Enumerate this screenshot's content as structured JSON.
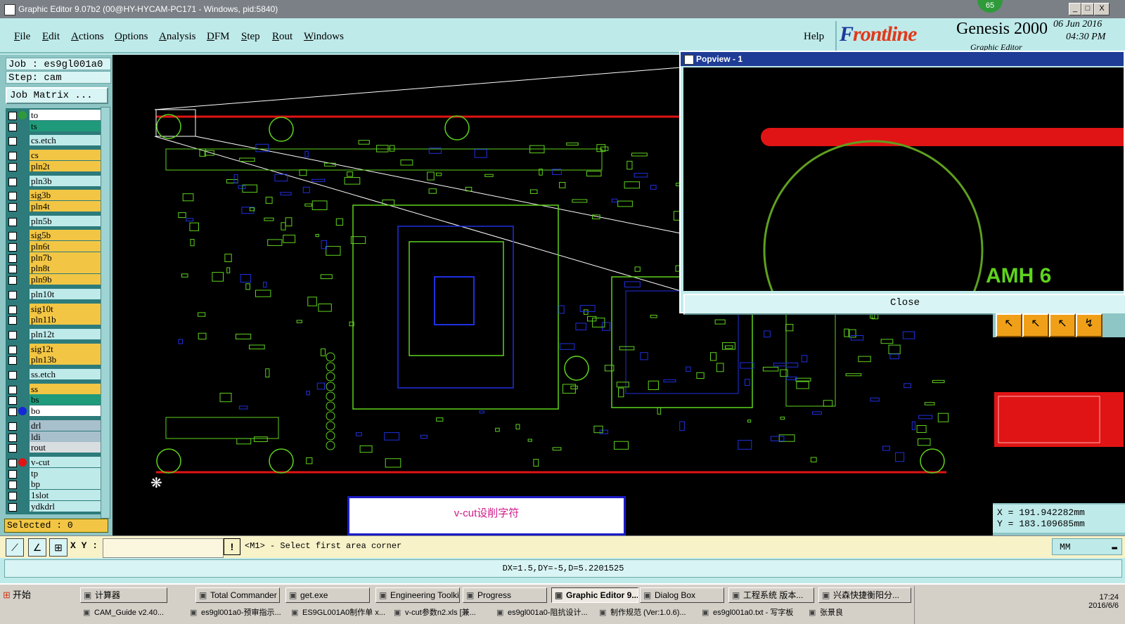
{
  "window": {
    "title": "Graphic Editor 9.07b2 (00@HY-HYCAM-PC171 - Windows, pid:5840)",
    "badge": "65",
    "min": "_",
    "max": "□",
    "close": "X"
  },
  "menu": {
    "items": [
      "File",
      "Edit",
      "Actions",
      "Options",
      "Analysis",
      "DFM",
      "Step",
      "Rout",
      "Windows"
    ],
    "help": "Help"
  },
  "brand": {
    "logo_a": "F",
    "logo_b": "rontline",
    "product": "Genesis 2000",
    "subtitle": "Graphic Editor",
    "date": "06 Jun 2016",
    "time": "04:30 PM"
  },
  "job": {
    "job_label": "Job : es9gl001a0",
    "step_label": "Step: cam",
    "matrix_button": "Job Matrix ..."
  },
  "layers": [
    {
      "name": "to",
      "bg": "#ffffff",
      "dot": "#2e9a3a",
      "group": 0
    },
    {
      "name": "ts",
      "bg": "#1f9a7a",
      "dot": "",
      "group": 0
    },
    {
      "name": "cs.etch",
      "bg": "#bfeaea",
      "dot": "",
      "group": 1
    },
    {
      "name": "cs",
      "bg": "#f2c644",
      "dot": "",
      "group": 2
    },
    {
      "name": "pln2t",
      "bg": "#f2c644",
      "dot": "",
      "group": 2
    },
    {
      "name": "pln3b",
      "bg": "#bfeaea",
      "dot": "",
      "group": 3
    },
    {
      "name": "sig3b",
      "bg": "#f2c644",
      "dot": "",
      "group": 4
    },
    {
      "name": "pln4t",
      "bg": "#f2c644",
      "dot": "",
      "group": 4
    },
    {
      "name": "pln5b",
      "bg": "#bfeaea",
      "dot": "",
      "group": 5
    },
    {
      "name": "sig5b",
      "bg": "#f2c644",
      "dot": "",
      "group": 6
    },
    {
      "name": "pln6t",
      "bg": "#f2c644",
      "dot": "",
      "group": 6
    },
    {
      "name": "pln7b",
      "bg": "#f2c644",
      "dot": "",
      "group": 6
    },
    {
      "name": "pln8t",
      "bg": "#f2c644",
      "dot": "",
      "group": 6
    },
    {
      "name": "pln9b",
      "bg": "#f2c644",
      "dot": "",
      "group": 6
    },
    {
      "name": "pln10t",
      "bg": "#bfeaea",
      "dot": "",
      "group": 7
    },
    {
      "name": "sig10t",
      "bg": "#f2c644",
      "dot": "",
      "group": 8
    },
    {
      "name": "pln11b",
      "bg": "#f2c644",
      "dot": "",
      "group": 8
    },
    {
      "name": "pln12t",
      "bg": "#bfeaea",
      "dot": "",
      "group": 9
    },
    {
      "name": "sig12t",
      "bg": "#f2c644",
      "dot": "",
      "group": 10
    },
    {
      "name": "pln13b",
      "bg": "#f2c644",
      "dot": "",
      "group": 10
    },
    {
      "name": "ss.etch",
      "bg": "#bfeaea",
      "dot": "",
      "group": 11
    },
    {
      "name": "ss",
      "bg": "#f2c644",
      "dot": "",
      "group": 12
    },
    {
      "name": "bs",
      "bg": "#1f9a7a",
      "dot": "",
      "group": 12
    },
    {
      "name": "bo",
      "bg": "#ffffff",
      "dot": "#1428d8",
      "group": 12
    },
    {
      "name": "drl",
      "bg": "#a8c0cc",
      "dot": "",
      "group": 13
    },
    {
      "name": "ldi",
      "bg": "#a8c0cc",
      "dot": "",
      "group": 13
    },
    {
      "name": "rout",
      "bg": "#d8dde0",
      "dot": "",
      "group": 13
    },
    {
      "name": "v-cut",
      "bg": "#bfeaea",
      "dot": "#e01414",
      "group": 14
    },
    {
      "name": "tp",
      "bg": "#bfeaea",
      "dot": "",
      "group": 14
    },
    {
      "name": "bp",
      "bg": "#bfeaea",
      "dot": "",
      "group": 14
    },
    {
      "name": "1slot",
      "bg": "#bfeaea",
      "dot": "",
      "group": 14
    },
    {
      "name": "ydkdrl",
      "bg": "#bfeaea",
      "dot": "",
      "group": 14
    }
  ],
  "selected": "Selected : 0",
  "canvas_note": "v-cut设削字符",
  "popview": {
    "title": "Popview - 1",
    "label": "AMH 6",
    "close": "Close"
  },
  "coords": {
    "x": "X = 191.942282mm",
    "y": "Y = 183.109685mm"
  },
  "command": {
    "xy_label": "X Y :",
    "xy_value": "",
    "prompt": "<M1> - Select first area corner",
    "units": "MM"
  },
  "measure": "DX=1.5,DY=-5,D=5.2201525",
  "taskbar": {
    "start": "开始",
    "row1": [
      "计算器",
      "Total Commander ...",
      "get.exe",
      "Engineering Toolki...",
      "Progress",
      "Graphic Editor 9...",
      "Dialog Box",
      "工程系统  版本...",
      "兴森快捷衡阳分..."
    ],
    "row2": [
      "CAM_Guide v2.40...",
      "es9gl001a0-预审指示...",
      "ES9GL001A0制作单 x...",
      "v-cut参数n2.xls [兼...",
      "es9gl001a0-阻抗设计...",
      "制作规范 (Ver:1.0.6)...",
      "es9gl001a0.txt - 写字板",
      "张景良"
    ],
    "time": "17:24",
    "date": "2016/6/6"
  },
  "colors": {
    "accent": "#e01414",
    "trace": "#5fd21e",
    "copper": "#2030e0"
  }
}
